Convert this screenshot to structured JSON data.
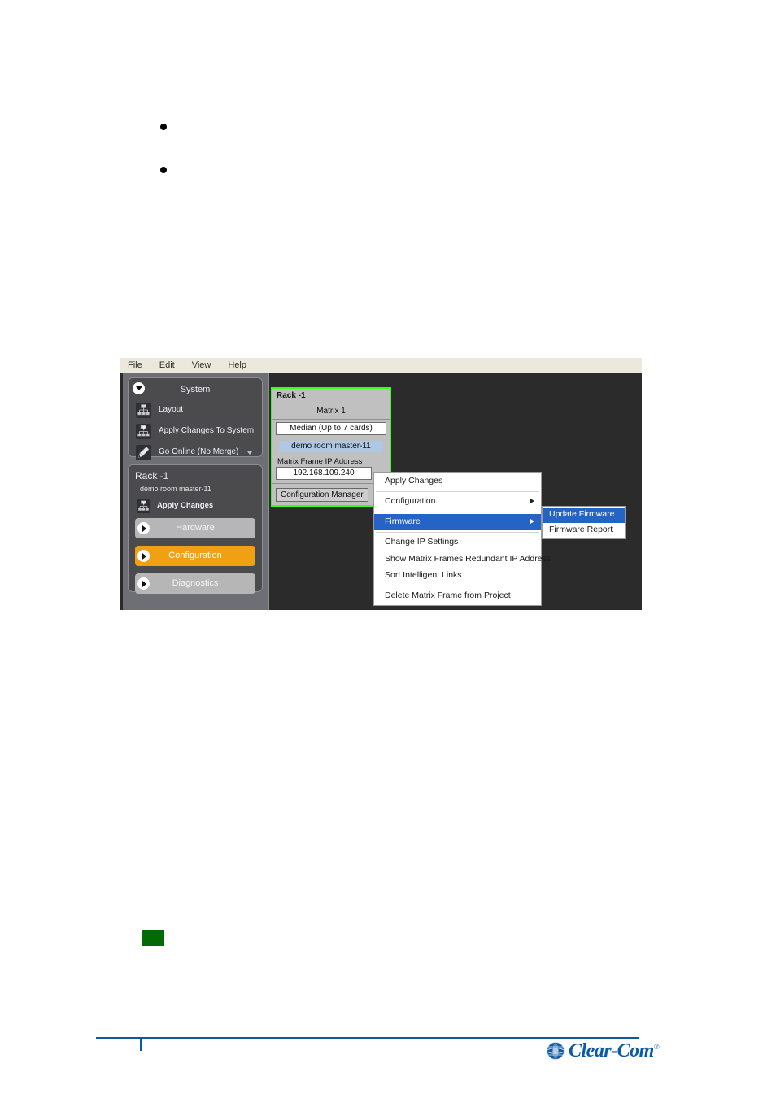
{
  "document": {
    "bullets": [
      "",
      ""
    ],
    "green_placeholder_color": "#046a06",
    "footer_rule_color": "#0a5aa8",
    "logo_text": "Clear-Com",
    "logo_registered_mark": "®"
  },
  "app": {
    "menubar": [
      {
        "label": "File"
      },
      {
        "label": "Edit"
      },
      {
        "label": "View"
      },
      {
        "label": "Help"
      }
    ],
    "sidebar": {
      "system_panel": {
        "title": "System",
        "collapse_icon": "chevron-down-icon",
        "items": [
          {
            "label": "Layout",
            "icon": "layout-hierarchy-icon",
            "has_caret": false
          },
          {
            "label": "Apply Changes To System",
            "icon": "apply-changes-icon",
            "has_caret": false
          },
          {
            "label": "Go Online (No Merge)",
            "icon": "go-online-pencil-icon",
            "has_caret": true
          }
        ]
      },
      "rack_panel": {
        "title": "Rack -1",
        "subtitle": "demo room master-11",
        "apply_changes_label": "Apply Changes",
        "apply_changes_icon": "apply-changes-icon",
        "nav_buttons": [
          {
            "label": "Hardware",
            "active": false
          },
          {
            "label": "Configuration",
            "active": true
          },
          {
            "label": "Diagnostics",
            "active": false
          }
        ],
        "active_color": "#f0a013"
      }
    },
    "canvas": {
      "rack_card": {
        "header": "Rack -1",
        "matrix_label": "Matrix 1",
        "frame_type": "Median (Up to 7 cards)",
        "frame_name": "demo room master-11",
        "ip_label": "Matrix Frame IP Address",
        "ip_value": "192.168.109.240",
        "config_button": "Configuration Manager",
        "selection_border_color": "#3aff16"
      },
      "context_menu": {
        "items": [
          {
            "label": "Apply Changes",
            "submenu": false,
            "highlight": false
          },
          {
            "label": "Configuration",
            "submenu": true,
            "highlight": false
          },
          {
            "label": "Firmware",
            "submenu": true,
            "highlight": true
          },
          {
            "label": "Change IP Settings",
            "submenu": false,
            "highlight": false
          },
          {
            "label": "Show Matrix Frames Redundant IP Address",
            "submenu": false,
            "highlight": false
          },
          {
            "label": "Sort Intelligent Links",
            "submenu": false,
            "highlight": false
          },
          {
            "label": "Delete Matrix Frame from Project",
            "submenu": false,
            "highlight": false
          }
        ],
        "highlight_color": "#2563c4"
      },
      "firmware_submenu": {
        "items": [
          {
            "label": "Update Firmware",
            "highlight": true
          },
          {
            "label": "Firmware Report",
            "highlight": false
          }
        ]
      }
    }
  }
}
